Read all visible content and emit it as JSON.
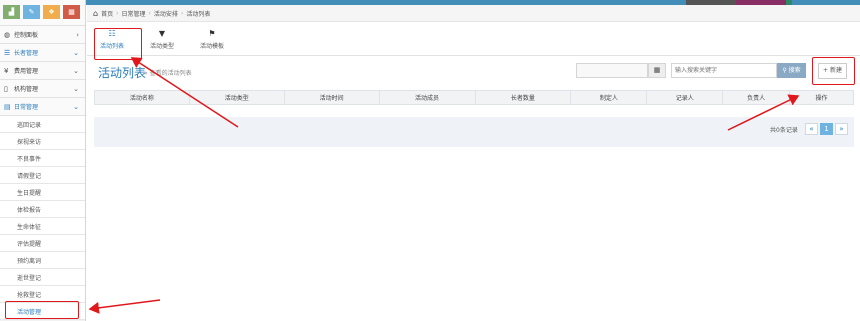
{
  "colors": {
    "accent": "#2b7dbc",
    "highlight": "#e0171b",
    "sc_green": "#82af6f",
    "sc_blue": "#6fb3e0",
    "sc_orange": "#f0ad4e",
    "sc_red": "#d15b47"
  },
  "sidebar": {
    "shortcuts": [
      {
        "icon": "chart-icon",
        "glyph": "▟"
      },
      {
        "icon": "pencil-icon",
        "glyph": "✎"
      },
      {
        "icon": "users-icon",
        "glyph": "❖"
      },
      {
        "icon": "cogs-icon",
        "glyph": "▦"
      }
    ],
    "menus": [
      {
        "label": "控制面板",
        "icon": "dashboard-icon",
        "glyph": "◍",
        "arrow": "›"
      },
      {
        "label": "长者管理",
        "icon": "list-icon",
        "glyph": "☰",
        "arrow": "⌄"
      },
      {
        "label": "费用管理",
        "icon": "yen-icon",
        "glyph": "¥",
        "arrow": "⌄"
      },
      {
        "label": "机构管理",
        "icon": "building-icon",
        "glyph": "▯",
        "arrow": "⌄"
      },
      {
        "label": "日常管理",
        "icon": "calendar-icon",
        "glyph": "▤",
        "arrow": "⌄"
      }
    ],
    "subitems": [
      "巡回记录",
      "探视来访",
      "不良事件",
      "请假登记",
      "生日提醒",
      "体检报告",
      "生命体征",
      "评估提醒",
      "预约离词",
      "逝世登记",
      "抢救登记",
      "活动管理"
    ]
  },
  "breadcrumb": {
    "home_icon": "⌂",
    "items": [
      "首页",
      "日常管理",
      "活动安排",
      "活动列表"
    ],
    "sep": "›"
  },
  "tabs": [
    {
      "label": "活动列表",
      "icon": "list-icon",
      "glyph": "☷"
    },
    {
      "label": "活动类型",
      "icon": "bookmark-icon",
      "glyph": "▼"
    },
    {
      "label": "活动模板",
      "icon": "flag-icon",
      "glyph": "⚑"
    }
  ],
  "page": {
    "title": "活动列表",
    "subtitle": "» 查看的活动列表"
  },
  "search": {
    "placeholder": "输入搜索关键字",
    "button_label": "搜索",
    "calendar_glyph": "▦"
  },
  "new_button": "+ 新建",
  "table": {
    "columns": [
      "活动名称",
      "活动类型",
      "活动时间",
      "活动成员",
      "长者数量",
      "制定人",
      "记录人",
      "负责人",
      "操作"
    ]
  },
  "pagination": {
    "record_count": "共0条记录",
    "prev": "«",
    "current": "1",
    "next": "»"
  }
}
